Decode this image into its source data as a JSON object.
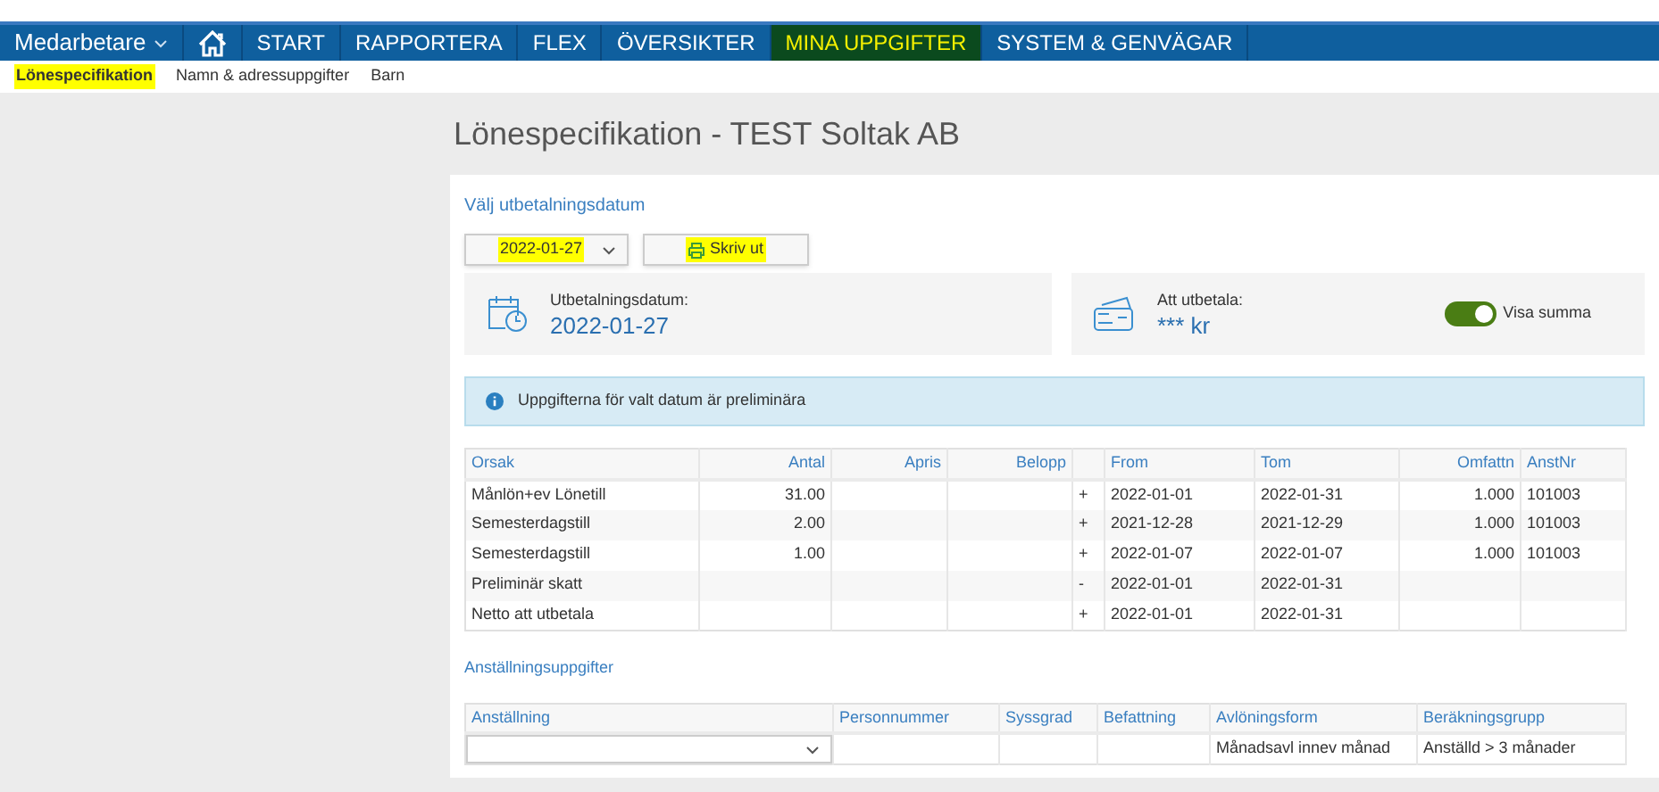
{
  "nav": {
    "menu": "Medarbetare",
    "items": [
      {
        "label": "START",
        "selected": false
      },
      {
        "label": "RAPPORTERA",
        "selected": false
      },
      {
        "label": "FLEX",
        "selected": false
      },
      {
        "label": "ÖVERSIKTER",
        "selected": false
      },
      {
        "label": "MINA UPPGIFTER",
        "selected": true
      },
      {
        "label": "SYSTEM & GENVÄGAR",
        "selected": false
      }
    ]
  },
  "subnav": [
    {
      "label": "Lönespecifikation",
      "selected": true
    },
    {
      "label": "Namn & adressuppgifter",
      "selected": false
    },
    {
      "label": "Barn",
      "selected": false
    }
  ],
  "page_title": "Lönespecifikation - TEST Soltak AB",
  "date_label": "Välj utbetalningsdatum",
  "date_select": {
    "value": "2022-01-27",
    "highlighted": true
  },
  "print_button": {
    "label": "Skriv ut",
    "highlighted": true
  },
  "payment_date": {
    "label": "Utbetalningsdatum:",
    "value": "2022-01-27"
  },
  "amount": {
    "label": "Att utbetala:",
    "value": "*** kr",
    "toggle": {
      "label": "Visa summa",
      "on": true
    }
  },
  "notice": "Uppgifterna för valt datum är preliminära",
  "pay_table": {
    "columns": [
      "Orsak",
      "Antal",
      "Apris",
      "Belopp",
      "",
      "From",
      "Tom",
      "Omfattn",
      "AnstNr"
    ],
    "rows": [
      [
        "Månlön+ev Lönetill",
        "31.00",
        "",
        "",
        "+",
        "2022-01-01",
        "2022-01-31",
        "1.000",
        "101003"
      ],
      [
        "Semesterdagstill",
        "2.00",
        "",
        "",
        "+",
        "2021-12-28",
        "2021-12-29",
        "1.000",
        "101003"
      ],
      [
        "Semesterdagstill",
        "1.00",
        "",
        "",
        "+",
        "2022-01-07",
        "2022-01-07",
        "1.000",
        "101003"
      ],
      [
        "Preliminär skatt",
        "",
        "",
        "",
        "-",
        "2022-01-01",
        "2022-01-31",
        "",
        ""
      ],
      [
        "Netto att utbetala",
        "",
        "",
        "",
        "+",
        "2022-01-01",
        "2022-01-31",
        "",
        ""
      ]
    ]
  },
  "employment_label": "Anställningsuppgifter",
  "employment_table": {
    "columns": [
      "Anställning",
      "Personnummer",
      "Syssgrad",
      "Befattning",
      "Avlöningsform",
      "Beräkningsgrupp"
    ],
    "rows": [
      [
        "",
        "",
        "",
        "",
        "Månadsavl innev månad",
        "Anställd > 3 månader"
      ]
    ]
  }
}
